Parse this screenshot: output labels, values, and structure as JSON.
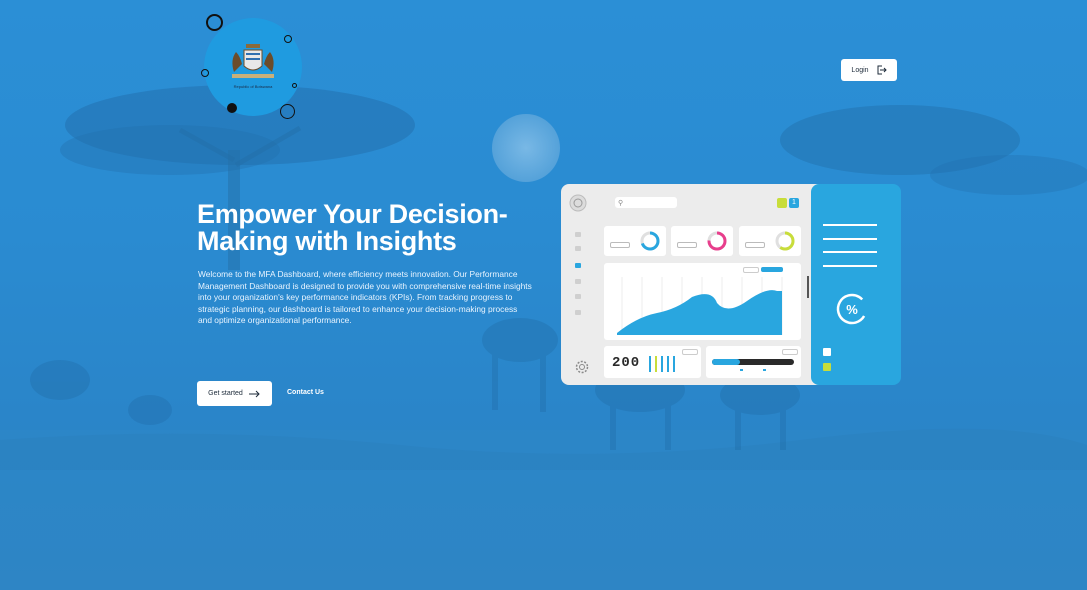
{
  "header": {
    "logo_caption": "Republic of Botswana",
    "login_label": "Login",
    "login_icon": "logout-arrow-icon"
  },
  "hero": {
    "title_line1": "Empower Your Decision-",
    "title_line2": "Making with Insights",
    "description": "Welcome to the MFA Dashboard, where efficiency meets innovation. Our Performance Management Dashboard is designed to provide you with comprehensive real-time insights into your organization's key performance indicators (KPIs). From tracking progress to strategic planning, our dashboard is tailored to enhance your decision-making process and optimize organizational performance.",
    "primary_cta": "Get started",
    "primary_cta_icon": "arrow-right-icon",
    "secondary_cta": "Contact Us"
  },
  "mockup": {
    "badge_count": "1",
    "counter": "200",
    "percent_symbol": "%",
    "kpi_colors": [
      "#29a6df",
      "#e83e8c",
      "#c8dd3a"
    ],
    "accent": "#29a6df"
  },
  "colors": {
    "background": "#2a8bd1",
    "accent": "#29a6df",
    "button_bg": "#ffffff"
  }
}
